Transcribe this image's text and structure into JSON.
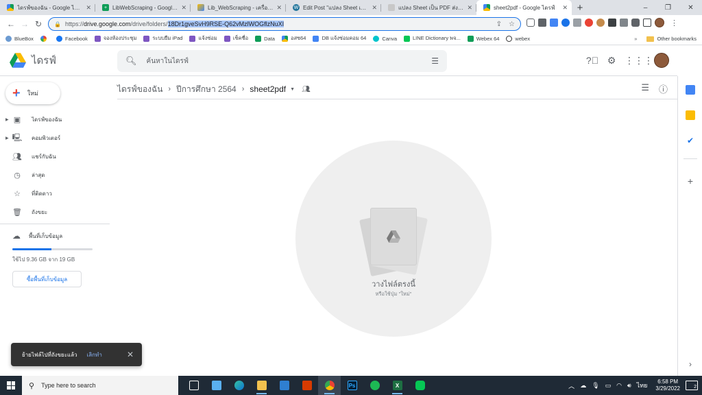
{
  "browser": {
    "tabs": [
      {
        "title": "ไดรฟ์ของฉัน - Google ไดรฟ์",
        "icon": "google-drive-icon",
        "active": false
      },
      {
        "title": "LibWebScraping - Google ชีต",
        "icon": "google-sheets-icon",
        "active": false
      },
      {
        "title": "Lib_WebScraping - เครื่องมือ...",
        "icon": "apps-script-icon",
        "active": false
      },
      {
        "title": "Edit Post \"แปลง Sheet เป็น PDF",
        "icon": "wordpress-icon",
        "active": false
      },
      {
        "title": "แปลง Sheet เป็น PDF ส่งเข้า Li...",
        "icon": "blog-icon",
        "active": false
      },
      {
        "title": "sheet2pdf - Google ไดรฟ์",
        "icon": "google-drive-icon",
        "active": true
      }
    ],
    "new_tab": "+",
    "window_controls": {
      "minimize": "–",
      "maximize": "❐",
      "close": "✕"
    },
    "url": {
      "prefix": "https://",
      "host": "drive.google.com",
      "path": "/drive/folders/",
      "selected": "18Dr1gveSvH9RSE-Q62vMzlWOGflzNuXI"
    },
    "bookmarks": [
      {
        "label": "BlueBox",
        "color": "#6c9bd2"
      },
      {
        "label": "",
        "color": "#4285f4"
      },
      {
        "label": "Facebook",
        "color": "#1877f2"
      },
      {
        "label": "จองห้องประชุม",
        "color": "#7e57c2"
      },
      {
        "label": "ระบบยืม iPad",
        "color": "#7e57c2"
      },
      {
        "label": "แจ้งซ่อม",
        "color": "#7e57c2"
      },
      {
        "label": "เช็คชื่อ",
        "color": "#7e57c2"
      },
      {
        "label": "Data",
        "color": "#0f9d58"
      },
      {
        "label": "อสซ64",
        "color": "#fbbc04"
      },
      {
        "label": "DB แจ้งซ่อมคอม 64",
        "color": "#4285f4"
      },
      {
        "label": "Canva",
        "color": "#00c4cc"
      },
      {
        "label": "LINE Dictionary พจ...",
        "color": "#06c755"
      },
      {
        "label": "Webex 64",
        "color": "#0f9d58"
      },
      {
        "label": "webex",
        "color": "#333333"
      }
    ],
    "bookmarks_more": "»",
    "other_bookmarks": "Other bookmarks"
  },
  "drive": {
    "app_name": "ไดรฟ์",
    "search_placeholder": "ค้นหาในไดรฟ์",
    "new_button": "ใหม่",
    "nav": [
      {
        "label": "ไดรฟ์ของฉัน",
        "icon": "my-drive-icon",
        "expandable": true
      },
      {
        "label": "คอมพิวเตอร์",
        "icon": "computers-icon",
        "expandable": true
      },
      {
        "label": "แชร์กับฉัน",
        "icon": "shared-icon",
        "expandable": false
      },
      {
        "label": "ล่าสุด",
        "icon": "clock-icon",
        "expandable": false
      },
      {
        "label": "ที่ติดดาว",
        "icon": "star-icon",
        "expandable": false
      },
      {
        "label": "ถังขยะ",
        "icon": "trash-icon",
        "expandable": false
      }
    ],
    "storage": {
      "label": "พื้นที่เก็บข้อมูล",
      "used_text": "ใช้ไป 9.36 GB จาก 19 GB",
      "used_fraction": 0.49,
      "buy_button": "ซื้อพื้นที่เก็บข้อมูล"
    },
    "breadcrumb": [
      "ไดรฟ์ของฉัน",
      "ปีการศึกษา 2564",
      "sheet2pdf"
    ],
    "empty_state": {
      "title": "วางไฟล์ตรงนี้",
      "subtitle": "หรือใช้ปุ่ม \"ใหม่\""
    },
    "snackbar": {
      "message": "ย้ายไฟล์ไปที่ถังขยะแล้ว",
      "action": "เลิกทำ"
    }
  },
  "taskbar": {
    "search_placeholder": "Type here to search",
    "time": "6:58 PM",
    "date": "3/29/2022",
    "language": "ไทย",
    "notifications": "2"
  }
}
